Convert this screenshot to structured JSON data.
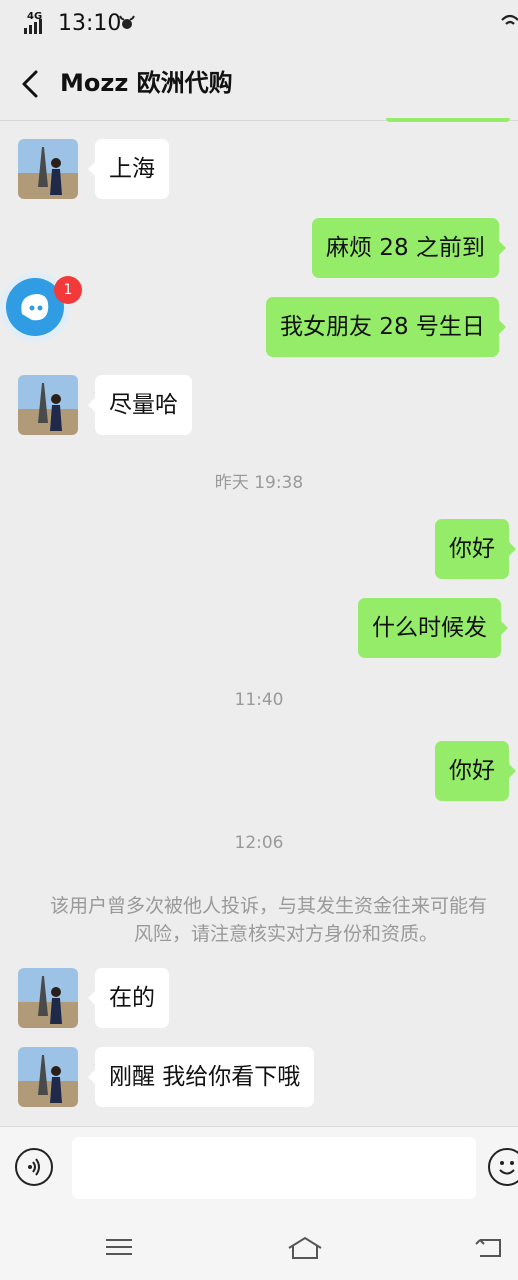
{
  "status_bar": {
    "network": "4G",
    "time": "13:10"
  },
  "header": {
    "back_icon": "chevron-left-icon",
    "title": "Mozz 欧洲代购"
  },
  "messages": [
    {
      "side": "received",
      "text": "上海"
    },
    {
      "side": "sent",
      "text": "麻烦 28 之前到"
    },
    {
      "side": "sent",
      "text": "我女朋友 28 号生日"
    },
    {
      "side": "received",
      "text": "尽量哈"
    },
    {
      "side": "sent",
      "text": "你好"
    },
    {
      "side": "sent",
      "text": "什么时候发"
    },
    {
      "side": "sent",
      "text": "你好"
    },
    {
      "side": "received",
      "text": "在的"
    },
    {
      "side": "received",
      "text": "刚醒 我给你看下哦"
    }
  ],
  "timestamps": [
    "昨天 19:38",
    "11:40",
    "12:06"
  ],
  "system_notice": {
    "line1": "该用户曾多次被他人投诉，与其发生资金往来可能有",
    "line2": "风险，请注意核实对方身份和资质。"
  },
  "floating_badge": {
    "count": "1",
    "icon": "chat-assistant-icon"
  },
  "input_bar": {
    "value": "",
    "voice_icon": "voice-icon",
    "emoji_icon": "emoji-icon"
  },
  "nav_bar": {
    "icons": [
      "menu-icon",
      "home-icon",
      "back-icon"
    ]
  },
  "colors": {
    "sent_bubble": "#95ec69",
    "received_bubble": "#ffffff",
    "background": "#ededed",
    "badge": "#f23a3a"
  }
}
